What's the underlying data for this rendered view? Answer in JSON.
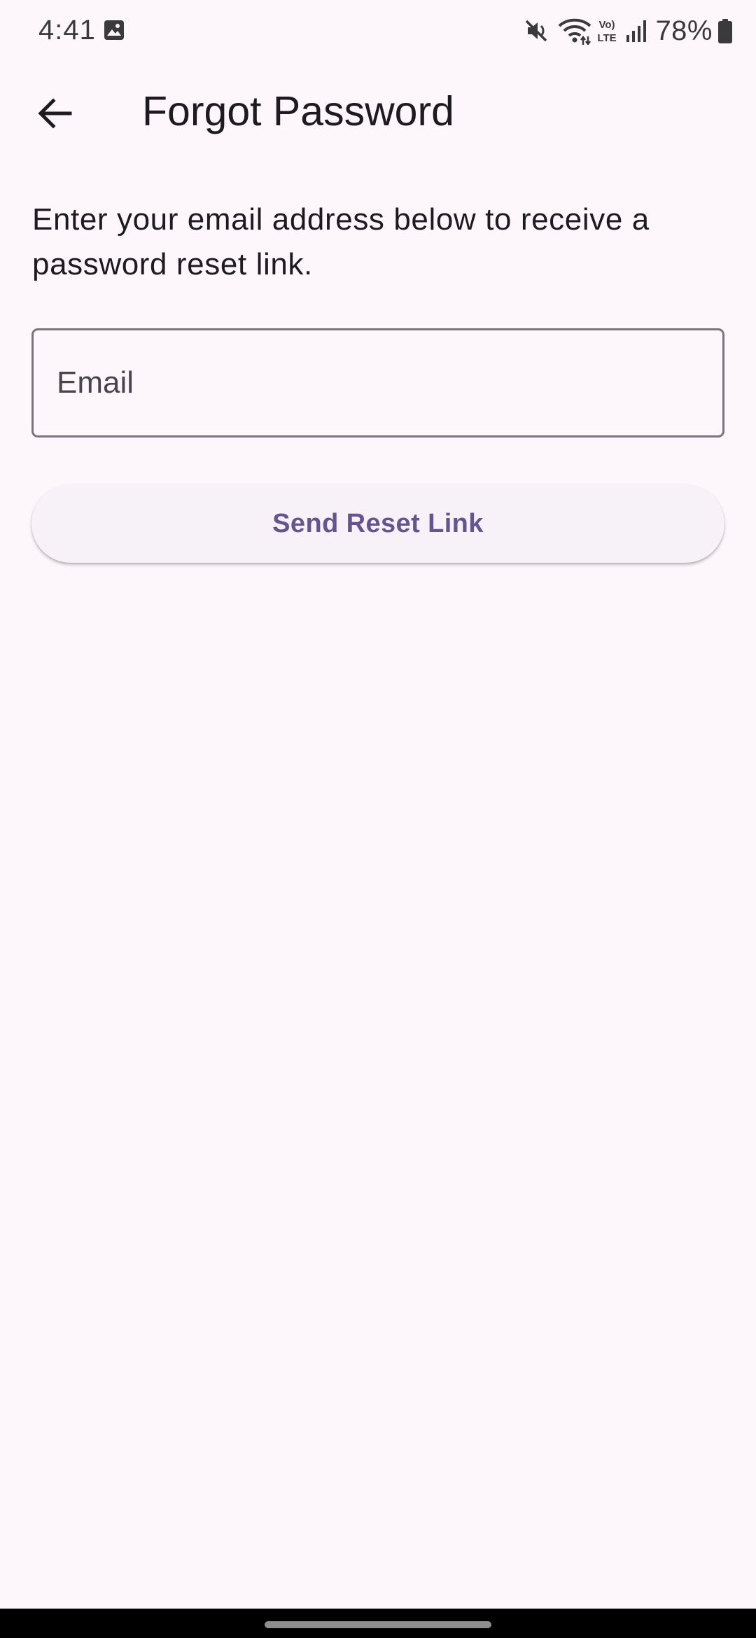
{
  "status_bar": {
    "time": "4:41",
    "battery_percent": "78%",
    "network_label_top": "Vo)",
    "network_label_bottom": "LTE",
    "icons": [
      "gallery-icon",
      "mute-icon",
      "wifi-icon",
      "volte-icon",
      "signal-icon",
      "battery-icon"
    ]
  },
  "app_bar": {
    "back_icon": "arrow-back-icon",
    "title": "Forgot Password"
  },
  "content": {
    "description": "Enter your email address below to receive a password reset link.",
    "email_field": {
      "placeholder": "Email",
      "value": ""
    },
    "send_button_label": "Send Reset Link"
  },
  "colors": {
    "background": "#FDF7FC",
    "primary_text": "#1D1B20",
    "outline": "#79747E",
    "button_background": "#F6F2F7",
    "button_text": "#65558F"
  }
}
